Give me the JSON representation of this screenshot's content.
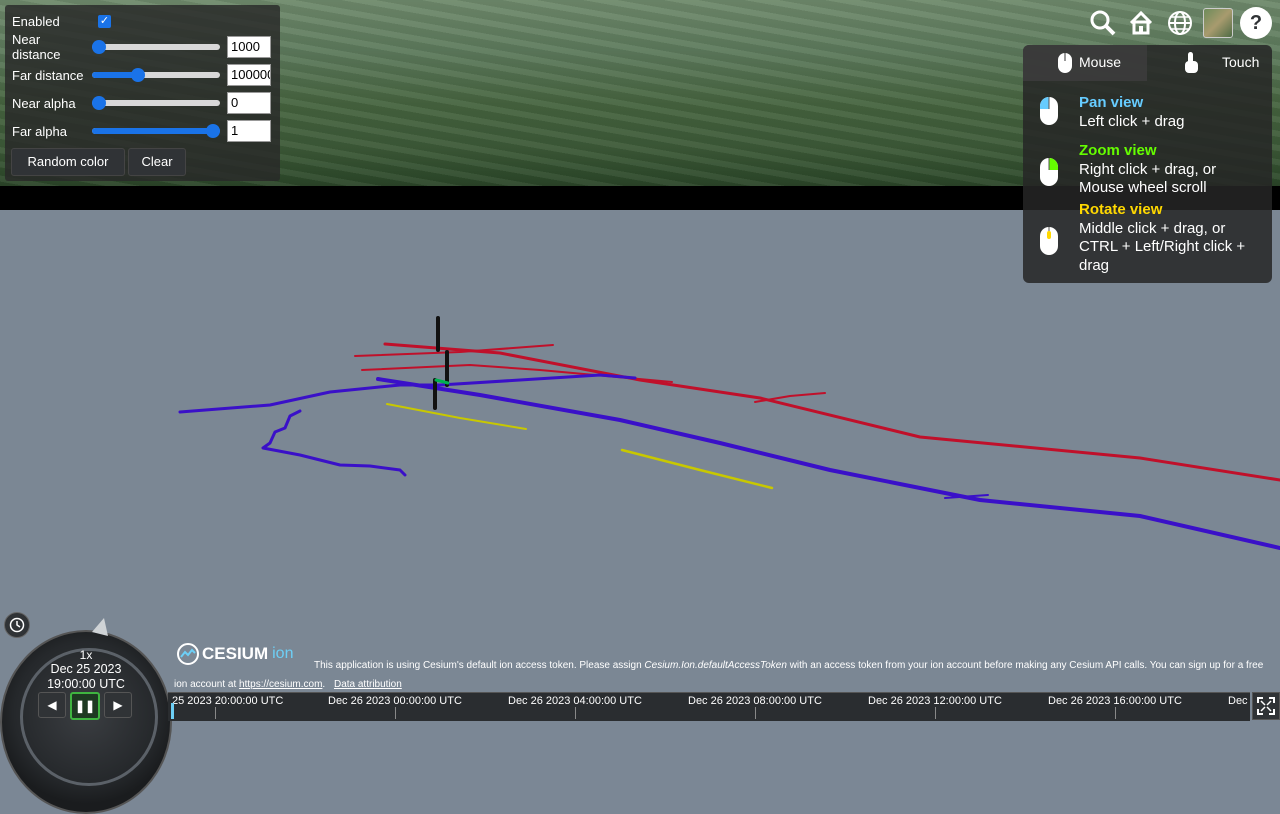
{
  "panel": {
    "enabled_label": "Enabled",
    "enabled_checked": true,
    "rows": [
      {
        "label": "Near distance",
        "value": "1000",
        "slider_fraction": 0.0
      },
      {
        "label": "Far distance",
        "value": "100000",
        "slider_fraction": 0.33
      },
      {
        "label": "Near alpha",
        "value": "0",
        "slider_fraction": 0.0
      },
      {
        "label": "Far alpha",
        "value": "1",
        "slider_fraction": 1.0
      }
    ],
    "random_color_label": "Random color",
    "clear_label": "Clear"
  },
  "toolbar": {
    "search_icon": "search-icon",
    "home_icon": "home-icon",
    "globe_icon": "globe-icon",
    "layers_icon": "imagery-layer-icon",
    "help_glyph": "?"
  },
  "navigation_help": {
    "tabs": {
      "mouse": "Mouse",
      "touch": "Touch"
    },
    "pan": {
      "title": "Pan view",
      "text": "Left click + drag",
      "color": "#66ccff"
    },
    "zoom": {
      "title": "Zoom view",
      "line1": "Right click + drag, or",
      "line2": "Mouse wheel scroll",
      "color": "#65fd00"
    },
    "rotate": {
      "title": "Rotate view",
      "line1": "Middle click + drag, or",
      "line2": "CTRL + Left/Right click +",
      "line3": "drag",
      "color": "#ffd800"
    }
  },
  "animation": {
    "speed": "1x",
    "date": "Dec 25 2023",
    "time": "19:00:00 UTC"
  },
  "credits": {
    "logo_text": "CESIUM",
    "logo_ion": "ion",
    "message_start": "This application is using Cesium's default ion access token. Please assign ",
    "message_code": "Cesium.Ion.defaultAccessToken",
    "message_end": " with an access token from your ion account before making any Cesium API calls. You can sign up for a free ion account at ",
    "link": "https://cesium.com",
    "message_tail": ".",
    "data_attribution": "Data attribution"
  },
  "timeline": {
    "labels": [
      "25 2023 20:00:00 UTC",
      "Dec 26 2023 00:00:00 UTC",
      "Dec 26 2023 04:00:00 UTC",
      "Dec 26 2023 08:00:00 UTC",
      "Dec 26 2023 12:00:00 UTC",
      "Dec 26 2023 16:00:00 UTC",
      "Dec"
    ]
  },
  "colors": {
    "red_lines": "#c0102a",
    "blue_lines": "#3a10c8",
    "yellow_lines": "#c8c800",
    "accent": "#1a73e8"
  }
}
